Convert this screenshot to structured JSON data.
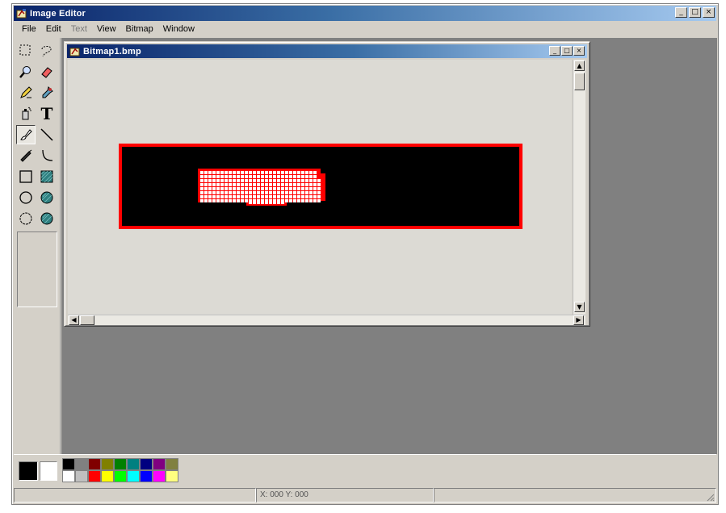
{
  "app": {
    "title": "Image Editor",
    "controls": {
      "minimize": "_",
      "maximize": "□",
      "close": "×"
    }
  },
  "menu": [
    {
      "label": "File",
      "enabled": true
    },
    {
      "label": "Edit",
      "enabled": true
    },
    {
      "label": "Text",
      "enabled": false
    },
    {
      "label": "View",
      "enabled": true
    },
    {
      "label": "Bitmap",
      "enabled": true
    },
    {
      "label": "Window",
      "enabled": true
    }
  ],
  "toolbox": {
    "tools": [
      {
        "name": "marquee-select-icon"
      },
      {
        "name": "lasso-icon"
      },
      {
        "name": "zoom-icon"
      },
      {
        "name": "eraser-icon"
      },
      {
        "name": "pencil-icon"
      },
      {
        "name": "dropper-icon"
      },
      {
        "name": "spray-can-icon"
      },
      {
        "name": "text-tool-icon",
        "glyph": "T"
      },
      {
        "name": "brush-icon",
        "active": true
      },
      {
        "name": "line-icon"
      },
      {
        "name": "paint-bucket-icon"
      },
      {
        "name": "curve-icon"
      },
      {
        "name": "rectangle-icon"
      },
      {
        "name": "filled-rectangle-icon"
      },
      {
        "name": "ellipse-icon"
      },
      {
        "name": "filled-ellipse-icon"
      },
      {
        "name": "ellipse-outline-icon"
      },
      {
        "name": "filled-circle-icon"
      }
    ]
  },
  "document": {
    "title": "Bitmap1.bmp",
    "controls": {
      "minimize": "_",
      "maximize": "□",
      "close": "×"
    },
    "bitmap_colors": {
      "background": "#000000",
      "border": "#ff0000",
      "pixel": "#ffffff",
      "pixel_edge": "#ff0000"
    }
  },
  "colors": {
    "foreground": "#000000",
    "background": "#ffffff",
    "palette": [
      "#000000",
      "#808080",
      "#800000",
      "#808000",
      "#008000",
      "#008080",
      "#000080",
      "#800080",
      "#808040",
      "#ffffff",
      "#c0c0c0",
      "#ff0000",
      "#ffff00",
      "#00ff00",
      "#00ffff",
      "#0000ff",
      "#ff00ff",
      "#ffff80"
    ]
  },
  "status": {
    "panes": [
      "",
      "X: 000 Y: 000",
      ""
    ]
  }
}
